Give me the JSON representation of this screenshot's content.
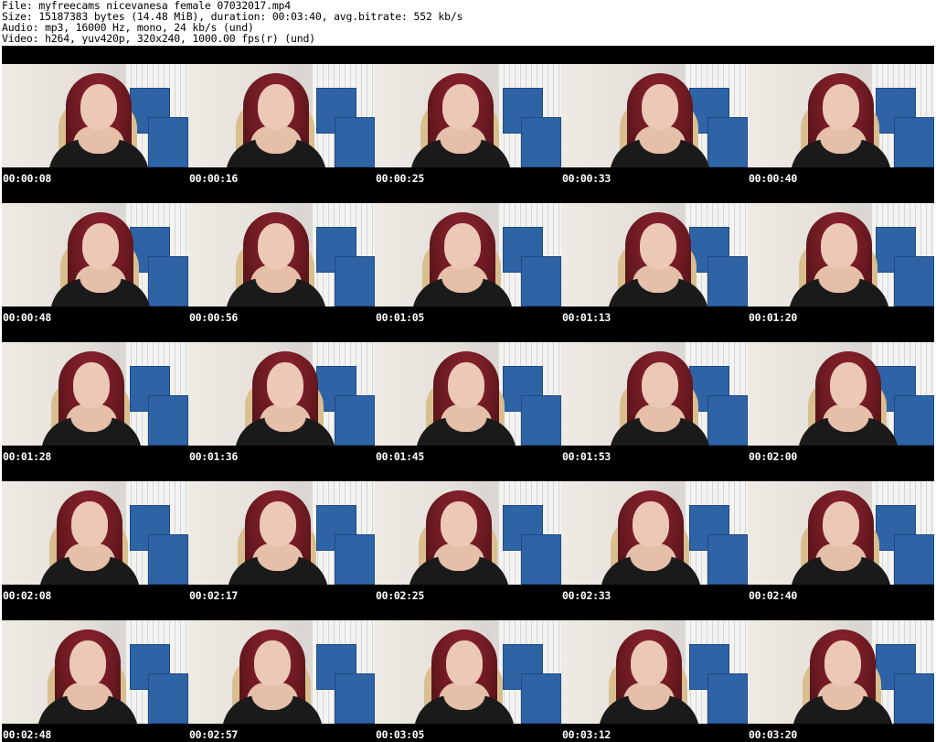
{
  "header": {
    "file_line": "File: myfreecams_nicevanesa_female_07032017.mp4",
    "size_line": "Size: 15187383 bytes (14.48 MiB), duration: 00:03:40, avg.bitrate: 552 kb/s",
    "audio_line": "Audio: mp3, 16000 Hz, mono, 24 kb/s (und)",
    "video_line": "Video: h264, yuv420p, 320x240, 1000.00 fps(r) (und)"
  },
  "colors": {
    "page_background": "#ffffff",
    "grid_background": "#000000",
    "timestamp_text": "#ffffff",
    "hair": "#6d1a22",
    "blue_box": "#2e63a6"
  },
  "timestamps": [
    [
      "00:00:08",
      "00:00:16",
      "00:00:25",
      "00:00:33",
      "00:00:40"
    ],
    [
      "00:00:48",
      "00:00:56",
      "00:01:05",
      "00:01:13",
      "00:01:20"
    ],
    [
      "00:01:28",
      "00:01:36",
      "00:01:45",
      "00:01:53",
      "00:02:00"
    ],
    [
      "00:02:08",
      "00:02:17",
      "00:02:25",
      "00:02:33",
      "00:02:40"
    ],
    [
      "00:02:48",
      "00:02:57",
      "00:03:05",
      "00:03:12",
      "00:03:20"
    ]
  ]
}
